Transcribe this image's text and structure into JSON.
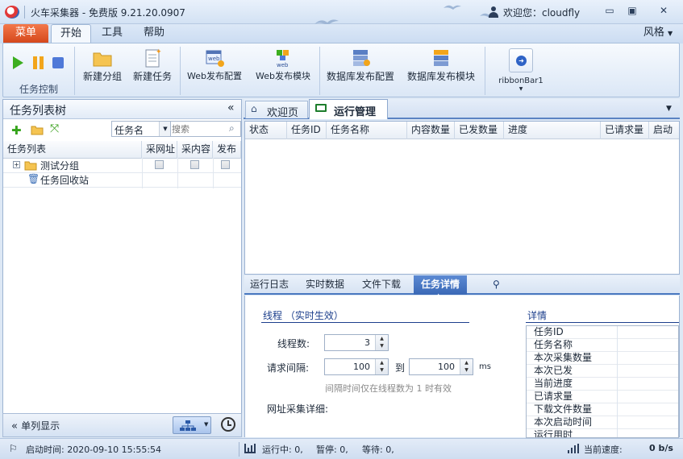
{
  "window": {
    "title": "火车采集器 - 免费版 9.21.20.0907",
    "welcome": "欢迎您：cloudfly"
  },
  "ribbon_tabs": {
    "menu": "菜单",
    "start": "开始",
    "tools": "工具",
    "help": "帮助",
    "style": "风格"
  },
  "ribbon": {
    "task_control": "任务控制",
    "new_group": "新建分组",
    "new_task": "新建任务",
    "web_publish_config": "Web发布配置",
    "web_publish_module": "Web发布模块",
    "db_publish_config": "数据库发布配置",
    "db_publish_module": "数据库发布模块",
    "ribbonbar1": "ribbonBar1",
    "web_icon_text": "web"
  },
  "left_panel": {
    "title": "任务列表树",
    "collapse": "«",
    "search_field": "任务名",
    "search_placeholder": "搜索",
    "columns": [
      "任务列表",
      "采网址",
      "采内容",
      "发布"
    ],
    "tree": [
      {
        "label": "测试分组",
        "type": "folder"
      },
      {
        "label": "任务回收站",
        "type": "recycle"
      }
    ],
    "single_column": "单列显示"
  },
  "doc_tabs": {
    "welcome": "欢迎页",
    "run_manage": "运行管理"
  },
  "run_grid": {
    "columns": [
      "状态",
      "任务ID",
      "任务名称",
      "内容数量",
      "已发数量",
      "进度",
      "已请求量",
      "启动"
    ]
  },
  "bottom_tabs": {
    "run_log": "运行日志",
    "realtime": "实时数据",
    "file_download": "文件下载",
    "task_detail": "任务详情"
  },
  "thread_section": {
    "title": "线程 （实时生效）",
    "thread_count_label": "线程数:",
    "thread_count": "3",
    "interval_label": "请求间隔:",
    "interval_from": "100",
    "to_label": "到",
    "interval_to": "100",
    "unit": "ms",
    "note": "间隔时间仅在线程数为 1 时有效",
    "url_detail_label": "网址采集详细:"
  },
  "detail_section": {
    "title": "详情",
    "rows": [
      "任务ID",
      "任务名称",
      "本次采集数量",
      "本次已发",
      "当前进度",
      "已请求量",
      "下载文件数量",
      "本次启动时间",
      "运行用时"
    ]
  },
  "status_bar": {
    "start_time": "启动时间: 2020-09-10 15:55:54",
    "running": "运行中: 0,",
    "paused": "暂停: 0,",
    "waiting": "等待: 0,",
    "speed_label": "当前速度:",
    "speed": "0 b/s"
  }
}
